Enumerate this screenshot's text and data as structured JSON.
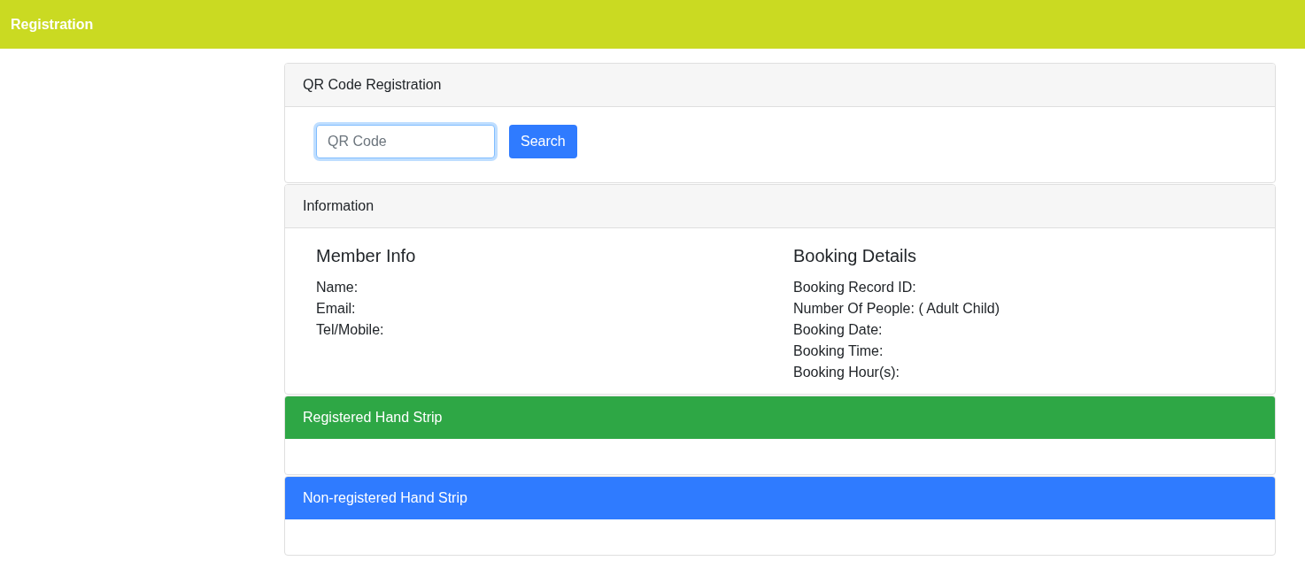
{
  "header": {
    "title": "Registration"
  },
  "qr_panel": {
    "title": "QR Code Registration",
    "search_field": {
      "placeholder": "QR Code",
      "focused": true
    },
    "search_button": "Search"
  },
  "info_panel": {
    "title": "Information",
    "columns": [
      {
        "heading": "Member Info",
        "lines": [
          "Name:",
          "Email:",
          "Tel/Mobile:"
        ]
      },
      {
        "heading": "Booking Details",
        "lines": [
          "Booking Record ID:",
          "Number Of People: ( Adult Child)",
          "Booking Date:",
          "Booking Time:",
          "Booking Hour(s):"
        ]
      }
    ]
  },
  "strip_panels": [
    {
      "title": "Registered Hand Strip",
      "kind": "success"
    },
    {
      "title": "Non-registered Hand Strip",
      "kind": "primary"
    }
  ]
}
